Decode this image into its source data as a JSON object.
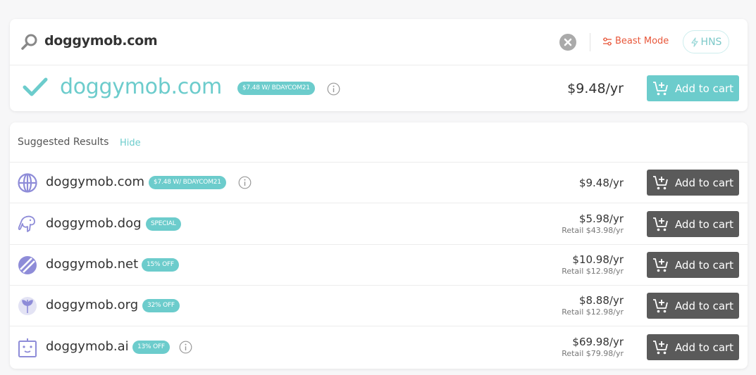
{
  "search": {
    "query": "doggymob.com",
    "beast_mode_label": "Beast Mode",
    "hns_label": "HNS"
  },
  "main_result": {
    "domain": "doggymob.com",
    "badge": "$7.48 W/ BDAYCOM21",
    "price": "$9.48/yr",
    "cart_label": "Add to cart"
  },
  "suggested": {
    "title": "Suggested Results",
    "hide_label": "Hide",
    "rows": [
      {
        "domain": "doggymob.com",
        "badge": "$7.48 W/ BDAYCOM21",
        "price": "$9.48/yr",
        "retail": "",
        "cart_label": "Add to cart",
        "icon": "globe-icon"
      },
      {
        "domain": "doggymob.dog",
        "badge": "SPECIAL",
        "price": "$5.98/yr",
        "retail": "Retail $43.98/yr",
        "cart_label": "Add to cart",
        "icon": "dog-icon"
      },
      {
        "domain": "doggymob.net",
        "badge": "15% OFF",
        "price": "$10.98/yr",
        "retail": "Retail $12.98/yr",
        "cart_label": "Add to cart",
        "icon": "net-icon"
      },
      {
        "domain": "doggymob.org",
        "badge": "32% OFF",
        "price": "$8.88/yr",
        "retail": "Retail $12.98/yr",
        "cart_label": "Add to cart",
        "icon": "org-icon"
      },
      {
        "domain": "doggymob.ai",
        "badge": "13% OFF",
        "price": "$69.98/yr",
        "retail": "Retail $79.98/yr",
        "cart_label": "Add to cart",
        "icon": "robot-icon"
      }
    ]
  },
  "colors": {
    "teal": "#6ccccc",
    "beast": "#e8573a",
    "dark_button": "#5a5a5a",
    "icon_purple": "#8e8cd8"
  }
}
